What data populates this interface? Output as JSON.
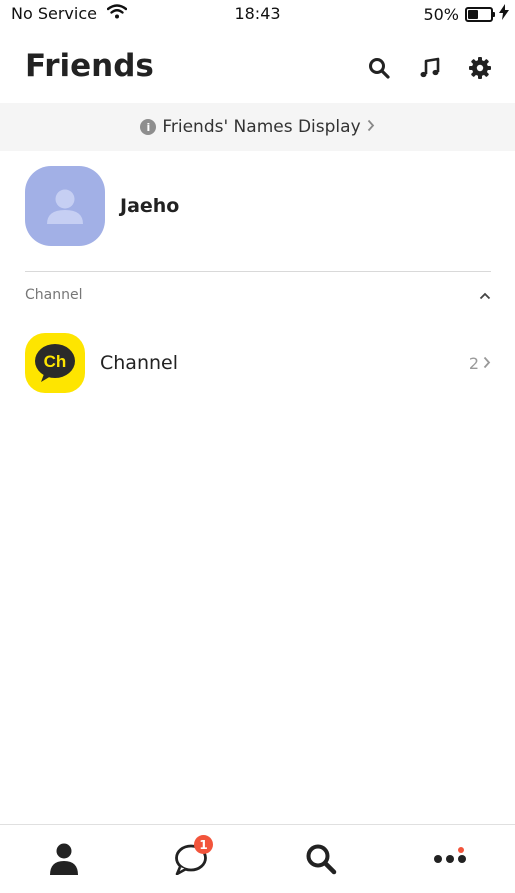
{
  "status_bar": {
    "carrier": "No Service",
    "time": "18:43",
    "battery_percent": "50%",
    "battery_level": 0.5
  },
  "header": {
    "title": "Friends"
  },
  "banner": {
    "label": "Friends' Names Display"
  },
  "profile": {
    "name": "Jaeho",
    "avatar_color": "#a2b0e6"
  },
  "channel_section": {
    "title": "Channel",
    "items": [
      {
        "label": "Channel",
        "count": "2",
        "logo_text": "Ch",
        "logo_color": "#fee500"
      }
    ]
  },
  "tab_bar": {
    "tabs": [
      {
        "icon": "person-icon",
        "active": true
      },
      {
        "icon": "chat-bubble-icon",
        "badge": "1"
      },
      {
        "icon": "search-icon"
      },
      {
        "icon": "more-dots-icon",
        "dot": true
      }
    ],
    "badge_color": "#f2543b"
  }
}
